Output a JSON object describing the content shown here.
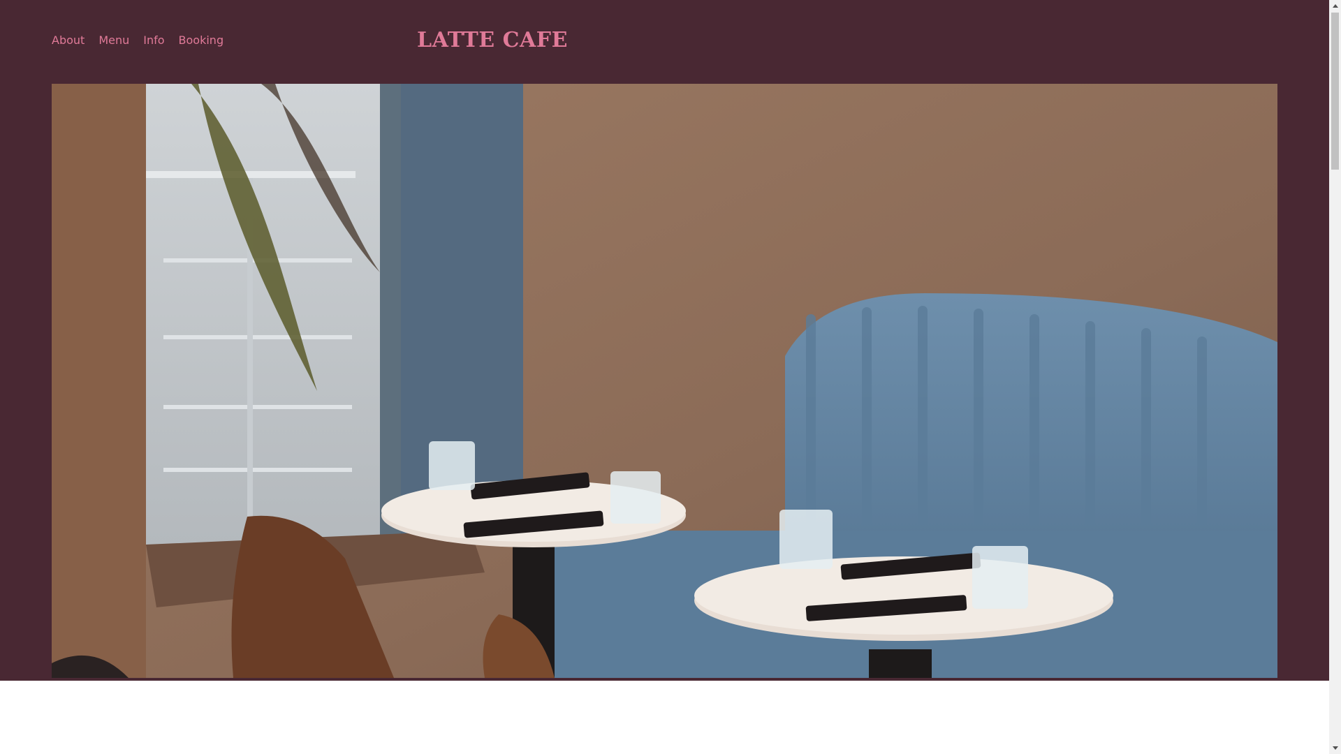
{
  "nav": {
    "items": [
      {
        "label": "About"
      },
      {
        "label": "Menu"
      },
      {
        "label": "Info"
      },
      {
        "label": "Booking"
      }
    ]
  },
  "brand": {
    "logo": "LATTE CAFE"
  },
  "colors": {
    "header_bg": "#492833",
    "accent": "#e07a98",
    "page_bg": "#ffffff"
  },
  "hero": {
    "image_semantic": "cafe-interior-photo"
  }
}
